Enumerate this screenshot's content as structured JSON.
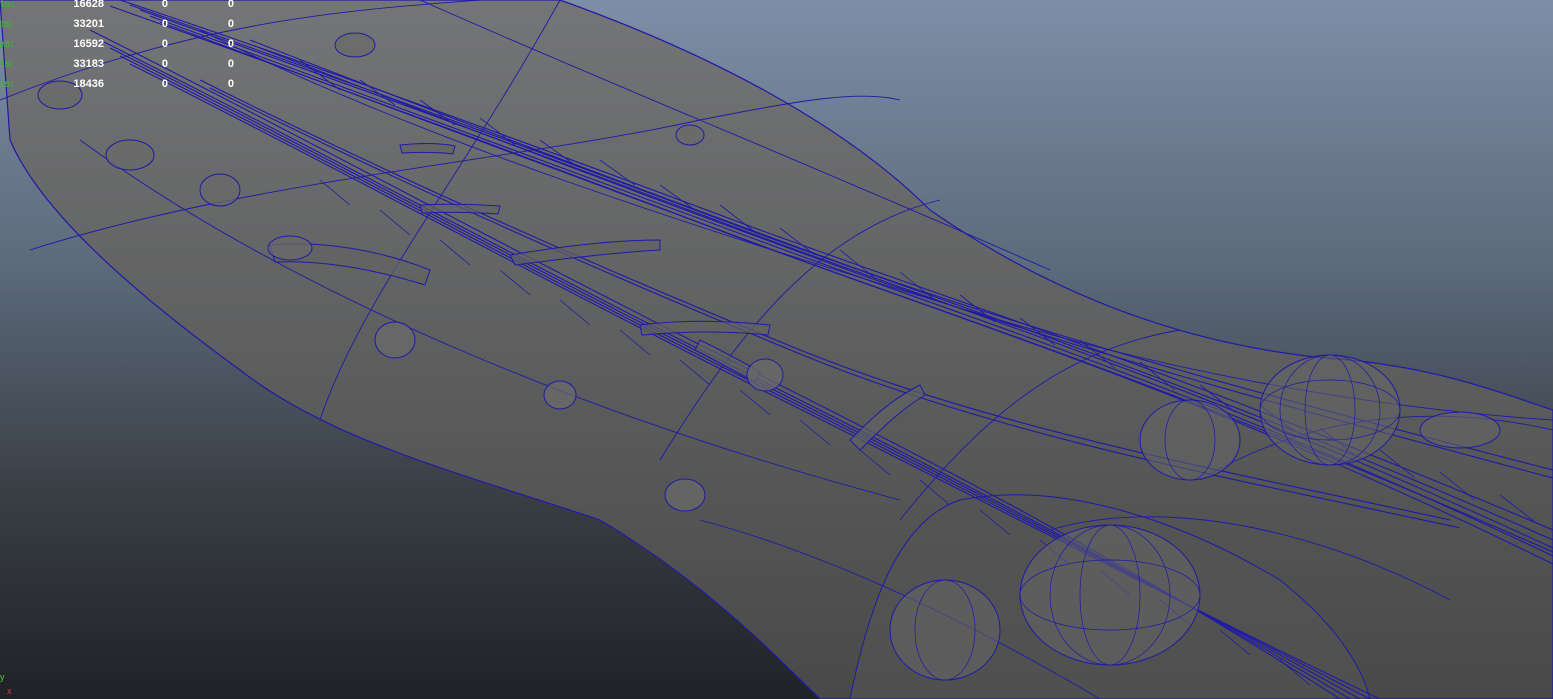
{
  "hud": {
    "rows": [
      {
        "label": "Verts:",
        "v1": "16628",
        "v2": "0",
        "v3": "0"
      },
      {
        "label": "Edges:",
        "v1": "33201",
        "v2": "0",
        "v3": "0"
      },
      {
        "label": "Faces:",
        "v1": "16592",
        "v2": "0",
        "v3": "0"
      },
      {
        "label": "Tris:",
        "v1": "33183",
        "v2": "0",
        "v3": "0"
      },
      {
        "label": "UVs:",
        "v1": "18436",
        "v2": "0",
        "v3": "0"
      }
    ]
  },
  "axis": {
    "y": "y",
    "x": "x"
  },
  "colors": {
    "wire": "#1f1aa6",
    "skin": "#686868",
    "skin_dark": "#4a4a4a",
    "hud_label": "#3fae3f",
    "hud_value": "#ffffff"
  }
}
